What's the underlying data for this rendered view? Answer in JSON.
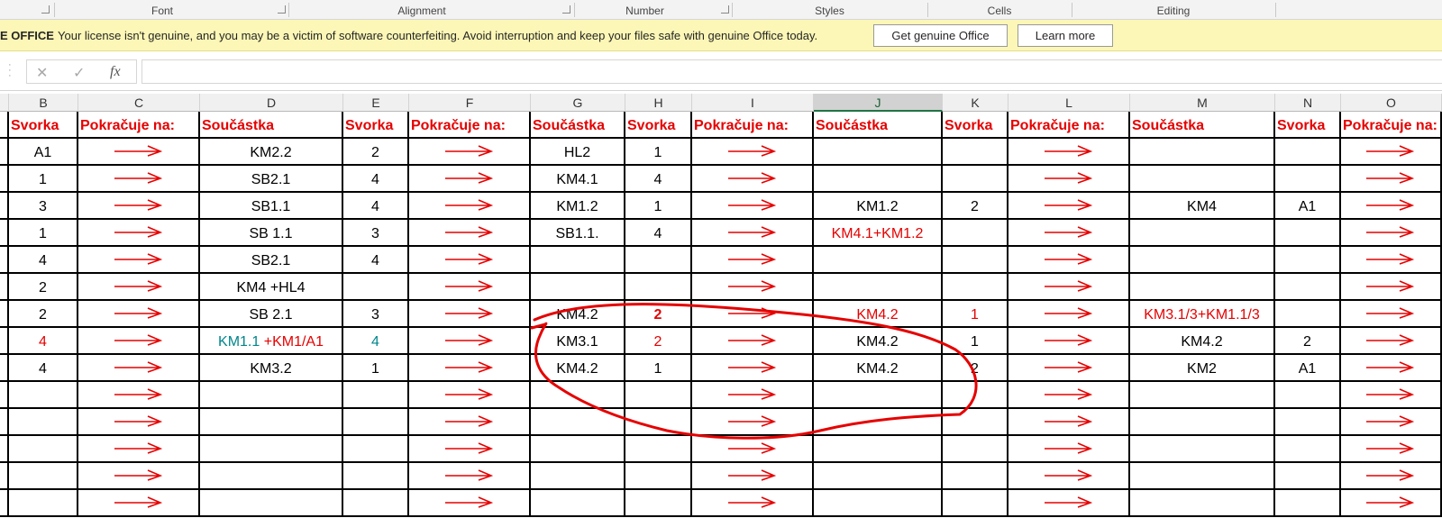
{
  "ribbon_groups": {
    "font": "Font",
    "alignment": "Alignment",
    "number": "Number",
    "styles": "Styles",
    "cells": "Cells",
    "editing": "Editing"
  },
  "message_bar": {
    "label": "E OFFICE",
    "text": "Your license isn't genuine, and you may be a victim of software counterfeiting. Avoid interruption and keep your files safe with genuine Office today.",
    "get_button": "Get genuine Office",
    "learn_button": "Learn more"
  },
  "formula_bar": {
    "cancel_icon": "✕",
    "enter_icon": "✓",
    "fx_label": "fx",
    "value": ""
  },
  "columns": [
    "B",
    "C",
    "D",
    "E",
    "F",
    "G",
    "H",
    "I",
    "J",
    "K",
    "L",
    "M",
    "N",
    "O"
  ],
  "selected_column": "J",
  "headers": [
    "Svorka",
    "Pokračuje na:",
    "Součástka",
    "Svorka",
    "Pokračuje na:",
    "Součástka",
    "Svorka",
    "Pokračuje na:",
    "Součástka",
    "Svorka",
    "Pokračuje na:",
    "Součástka",
    "Svorka",
    "Pokračuje na:"
  ],
  "rows": [
    {
      "B": "A1",
      "D": "KM2.2",
      "E": "2",
      "G": "HL2",
      "H": "1",
      "J": "",
      "K": "",
      "M": "",
      "N": ""
    },
    {
      "B": "1",
      "D": "SB2.1",
      "E": "4",
      "G": "KM4.1",
      "H": "4",
      "J": "",
      "K": "",
      "M": "",
      "N": ""
    },
    {
      "B": "3",
      "D": "SB1.1",
      "E": "4",
      "G": "KM1.2",
      "H": "1",
      "J": "KM1.2",
      "K": "2",
      "M": "KM4",
      "N": "A1"
    },
    {
      "B": "1",
      "D": "SB 1.1",
      "E": "3",
      "G": "SB1.1.",
      "H": "4",
      "J": "KM4.1+KM1.2",
      "K": "",
      "M": "",
      "N": ""
    },
    {
      "B": "4",
      "D": "SB2.1",
      "E": "4",
      "G": "",
      "H": "",
      "J": "",
      "K": "",
      "M": "",
      "N": ""
    },
    {
      "B": "2",
      "D": "KM4 +HL4",
      "E": "",
      "G": "",
      "H": "",
      "J": "",
      "K": "",
      "M": "",
      "N": ""
    },
    {
      "B": "2",
      "D": "SB 2.1",
      "E": "3",
      "G": "KM4.2",
      "H": "2",
      "J": "KM4.2",
      "K": "1",
      "M": "KM3.1/3+KM1.1/3",
      "N": ""
    },
    {
      "B": "4",
      "D": "",
      "D_a": "KM1.1",
      "D_b": "+KM1/A1",
      "E": "4",
      "G": "KM3.1",
      "H": "2",
      "J": "KM4.2",
      "K": "1",
      "M": "KM4.2",
      "N": "2"
    },
    {
      "B": "4",
      "D": "KM3.2",
      "E": "1",
      "G": "KM4.2",
      "H": "1",
      "J": "KM4.2",
      "K": "2",
      "M": "KM2",
      "N": "A1"
    },
    {
      "B": "",
      "D": "",
      "E": "",
      "G": "",
      "H": "",
      "J": "",
      "K": "",
      "M": "",
      "N": ""
    },
    {
      "B": "",
      "D": "",
      "E": "",
      "G": "",
      "H": "",
      "J": "",
      "K": "",
      "M": "",
      "N": ""
    },
    {
      "B": "",
      "D": "",
      "E": "",
      "G": "",
      "H": "",
      "J": "",
      "K": "",
      "M": "",
      "N": ""
    },
    {
      "B": "",
      "D": "",
      "E": "",
      "G": "",
      "H": "",
      "J": "",
      "K": "",
      "M": "",
      "N": ""
    },
    {
      "B": "",
      "D": "",
      "E": "",
      "G": "",
      "H": "",
      "J": "",
      "K": "",
      "M": "",
      "N": ""
    }
  ],
  "colors": {
    "header_text": "#e60000",
    "arrow": "#e60000",
    "annotation": "#e60000",
    "teal_text": "#00858c",
    "message_bar_bg": "#fcf7b6",
    "selected_column_accent": "#217346"
  }
}
